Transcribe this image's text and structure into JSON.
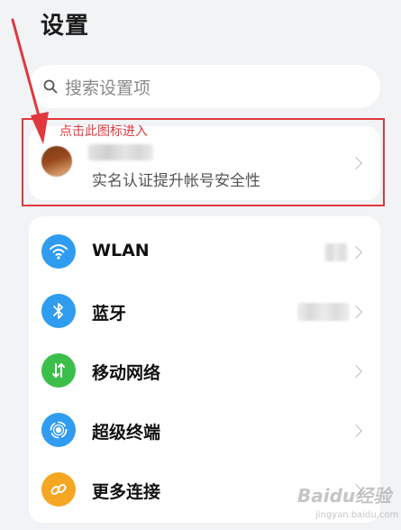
{
  "header": {
    "title": "设置"
  },
  "search": {
    "placeholder": "搜索设置项",
    "icon": "search-icon"
  },
  "account": {
    "subtitle": "实名认证提升帐号安全性",
    "avatar_colors": [
      "#7a3a16",
      "#c98a5a"
    ]
  },
  "annotation": {
    "text": "点击此图标进入",
    "color": "#e0383e"
  },
  "settings": {
    "items": [
      {
        "label": "WLAN",
        "icon": "wifi-icon",
        "icon_color": "#2f9cf0"
      },
      {
        "label": "蓝牙",
        "icon": "bluetooth-icon",
        "icon_color": "#2f9cf0"
      },
      {
        "label": "移动网络",
        "icon": "mobile-data-icon",
        "icon_color": "#3cbf4a"
      },
      {
        "label": "超级终端",
        "icon": "super-device-icon",
        "icon_color": "#2f9cf0"
      },
      {
        "label": "更多连接",
        "icon": "link-icon",
        "icon_color": "#f5a623"
      }
    ]
  },
  "watermark": {
    "main": "Baidu经验",
    "sub": "jingyan.baidu.com"
  }
}
